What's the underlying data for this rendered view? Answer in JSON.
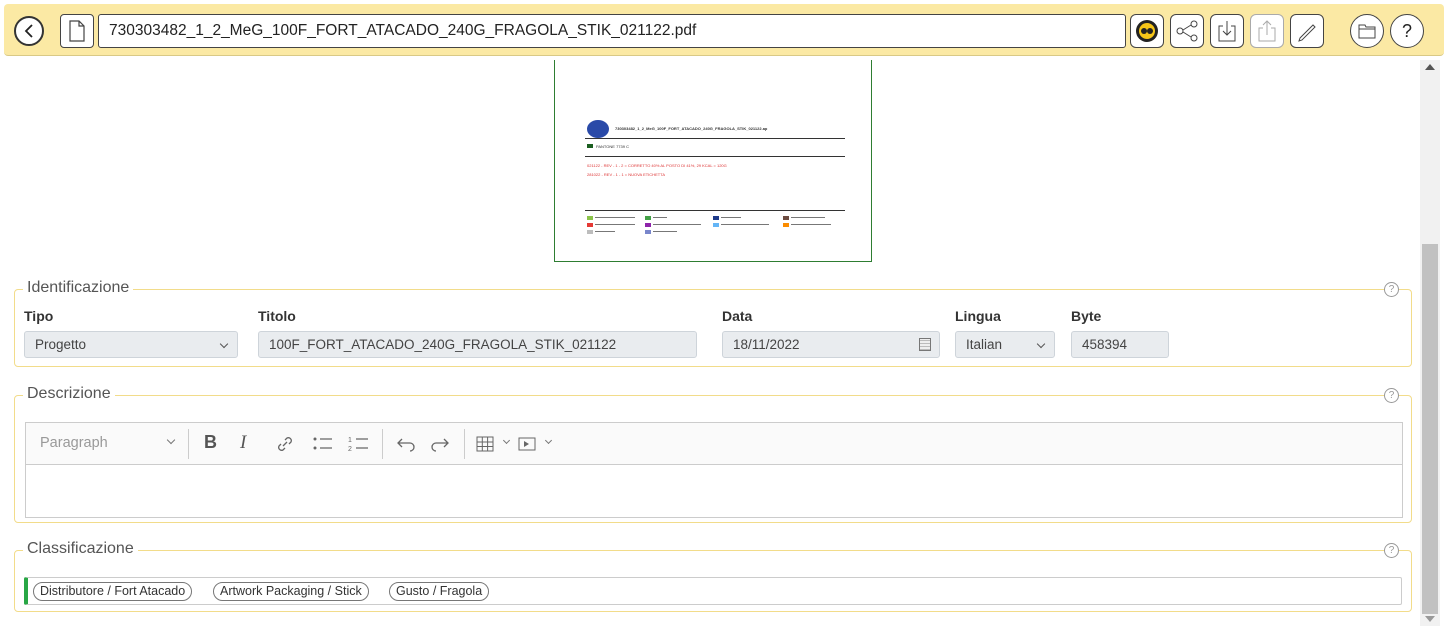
{
  "toolbar": {
    "filename": "730303482_1_2_MeG_100F_FORT_ATACADO_240G_FRAGOLA_STIK_021122.pdf",
    "icons": [
      "back-icon",
      "document-icon",
      "tones-icon",
      "share-icon",
      "download-icon",
      "upload-icon",
      "edit-icon",
      "folder-icon",
      "help-icon"
    ]
  },
  "preview": {
    "header": "730303482_1_2_MeG_100F_FORT_ATACADO_240G_FRAGOLA_STIK_021122.ap",
    "logo_text": "MOLTA",
    "color_label": "PANTONE 7739 C",
    "rev1": "021122 - REV - 1 - 2 = CORRETTO 40% AL POSTO DI 41%, 29 KCAL = 120G",
    "rev2": "281022 - REV - 1 - 1 = NUOVA ETICHETTA"
  },
  "identificazione": {
    "legend": "Identificazione",
    "tipo_label": "Tipo",
    "tipo_value": "Progetto",
    "titolo_label": "Titolo",
    "titolo_value": "100F_FORT_ATACADO_240G_FRAGOLA_STIK_021122",
    "data_label": "Data",
    "data_value": "18/11/2022",
    "lingua_label": "Lingua",
    "lingua_value": "Italian",
    "byte_label": "Byte",
    "byte_value": "458394"
  },
  "descrizione": {
    "legend": "Descrizione",
    "paragraph_label": "Paragraph",
    "bold": "B",
    "italic": "I"
  },
  "classificazione": {
    "legend": "Classificazione",
    "tags": [
      "Distributore / Fort Atacado",
      "Artwork Packaging / Stick",
      "Gusto / Fragola"
    ]
  },
  "help_glyph": "?",
  "colors": {
    "toolbar_bg": "#fbe9a4",
    "section_border": "#f2dc8a",
    "tag_accent": "#28a745",
    "preview_border": "#2e7d32"
  }
}
